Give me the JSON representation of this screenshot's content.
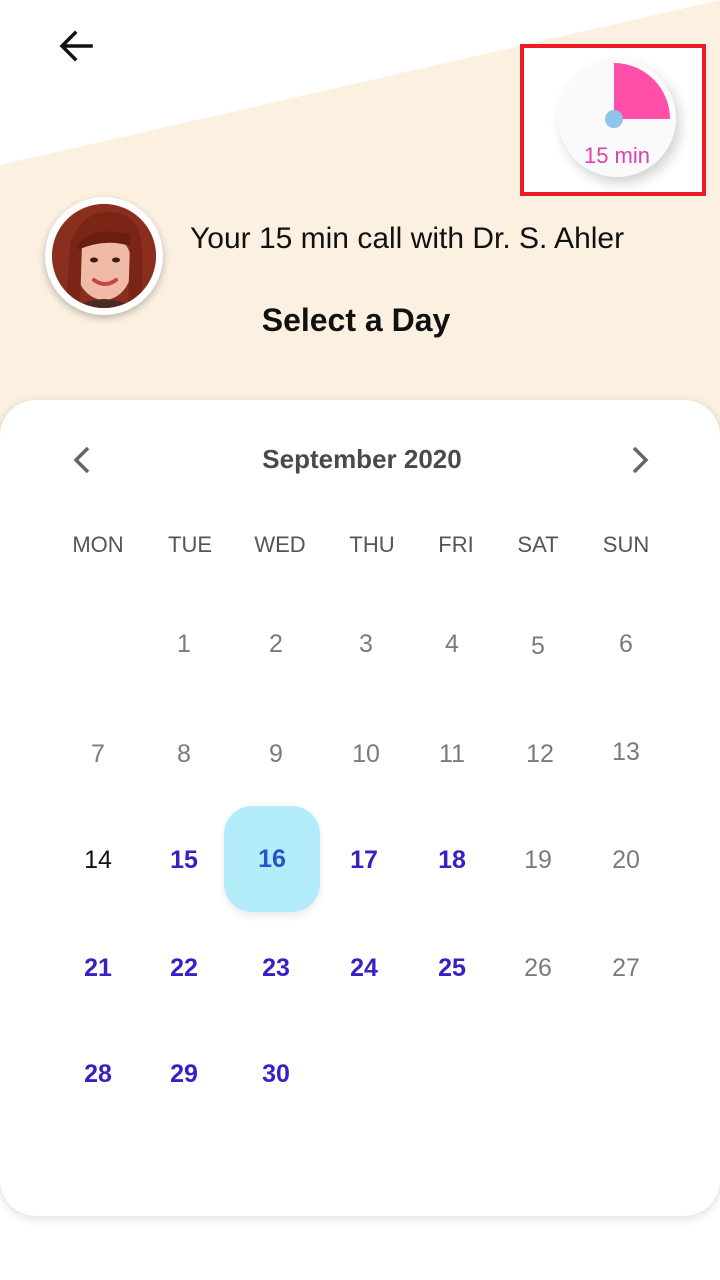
{
  "header": {
    "back_icon": "arrow-left-icon",
    "timer": {
      "label": "15 min",
      "progress_fraction": 0.25,
      "accent_color": "#ff4fa8",
      "dot_color": "#8ec5e8"
    }
  },
  "doctor": {
    "title": "Your 15 min call with Dr. S. Ahler",
    "avatar": "doctor-avatar"
  },
  "page": {
    "heading": "Select a Day"
  },
  "calendar": {
    "month_label": "September 2020",
    "prev_icon": "chevron-left-icon",
    "next_icon": "chevron-right-icon",
    "weekdays": [
      "MON",
      "TUE",
      "WED",
      "THU",
      "FRI",
      "SAT",
      "SUN"
    ],
    "days": {
      "d1": "1",
      "d2": "2",
      "d3": "3",
      "d4": "4",
      "d5": "5",
      "d6": "6",
      "d7": "7",
      "d8": "8",
      "d9": "9",
      "d10": "10",
      "d11": "11",
      "d12": "12",
      "d13": "13",
      "d14": "14",
      "d15": "15",
      "d16": "16",
      "d17": "17",
      "d18": "18",
      "d19": "19",
      "d20": "20",
      "d21": "21",
      "d22": "22",
      "d23": "23",
      "d24": "24",
      "d25": "25",
      "d26": "26",
      "d27": "27",
      "d28": "28",
      "d29": "29",
      "d30": "30"
    },
    "selected_day": "16",
    "available_color": "#3a20c4",
    "selected_bg": "#b3ecf9"
  }
}
